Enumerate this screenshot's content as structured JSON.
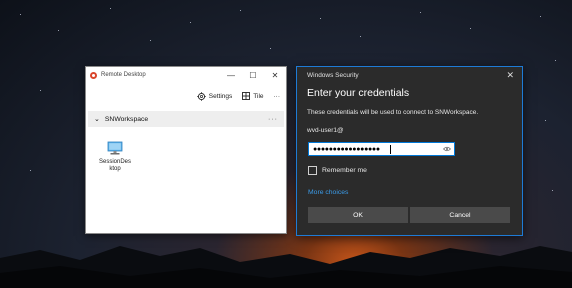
{
  "remote_desktop": {
    "title": "Remote Desktop",
    "controls": {
      "minimize": "—",
      "maximize": "☐",
      "close": "✕"
    },
    "toolbar": {
      "settings_label": "Settings",
      "tile_label": "Tile",
      "more_label": "···"
    },
    "group": {
      "chevron": "⌄",
      "name": "SNWorkspace",
      "more": "···"
    },
    "tile": {
      "line1": "SessionDes",
      "line2": "ktop"
    }
  },
  "security_dialog": {
    "title": "Windows Security",
    "close": "✕",
    "heading": "Enter your credentials",
    "description": "These credentials will be used to connect to SNWorkspace.",
    "username": "wvd-user1@",
    "password_mask": "●●●●●●●●●●●●●●●●●",
    "remember_label": "Remember me",
    "more_choices": "More choices",
    "ok_label": "OK",
    "cancel_label": "Cancel",
    "accent_color": "#0078d7",
    "link_color": "#3b9be8"
  },
  "icons": [
    "remote-desktop-app-icon",
    "gear-icon",
    "tile-icon",
    "chevron-down-icon",
    "computer-icon",
    "eye-icon",
    "close-icon"
  ]
}
